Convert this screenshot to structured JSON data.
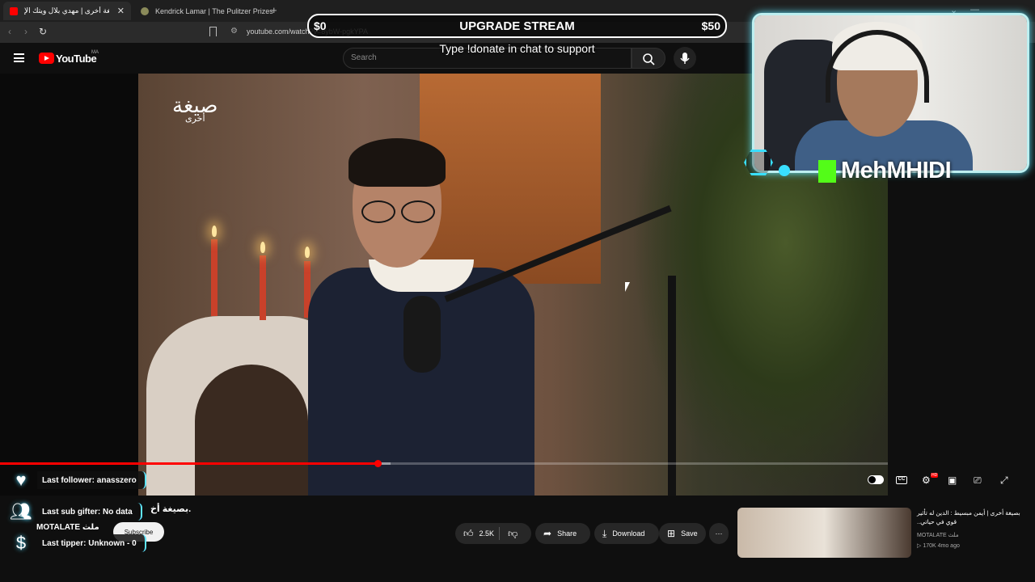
{
  "browser": {
    "tabs": [
      {
        "title": "بصيغة أخرى | مهدي بلال ويتك الإ",
        "active": true,
        "favicon_color": "#ff0000"
      },
      {
        "title": "Kendrick Lamar | The Pulitzer Prizes",
        "active": false,
        "favicon_color": "#8a8a5a"
      }
    ],
    "new_tab": "+",
    "url": "youtube.com/watch?v=8ybW-pgkYPA"
  },
  "youtube": {
    "logo_text": "YouTube",
    "country_code": "MA",
    "search_placeholder": "Search"
  },
  "video": {
    "show_logo_line1": "صيغة",
    "show_logo_line2": "أخرى",
    "progress_fraction": 0.425,
    "buffered_fraction": 0.44,
    "title": "بصيغة أخ.",
    "channel": "MOTALATE ملث",
    "subscribe_label": "Subscribe",
    "actions": {
      "likes": "2.5K",
      "share": "Share",
      "download": "Download",
      "save": "Save",
      "more": "···"
    }
  },
  "related": {
    "title": "بصيغة أخرى | أيمن مبسيط : الدين له تأثير قوي في حياتي..",
    "channel": "MOTALATE ملث",
    "stats": "▷ 170K  4mo ago"
  },
  "overlay": {
    "upgrade_low": "$0",
    "upgrade_title": "UPGRADE STREAM",
    "upgrade_high": "$50",
    "donate_hint": "Type !donate in chat to support",
    "streamer_name": "MehMHIDI",
    "alerts": [
      {
        "label": "Last follower: anasszero",
        "icon": "heart-icon"
      },
      {
        "label": "Last sub gifter: No data",
        "icon": "gift-users-icon"
      },
      {
        "label": "Last tipper: Unknown - 0",
        "icon": "dollar-icon"
      }
    ],
    "accent_color": "#39dfff",
    "kick_color": "#53fc18"
  }
}
